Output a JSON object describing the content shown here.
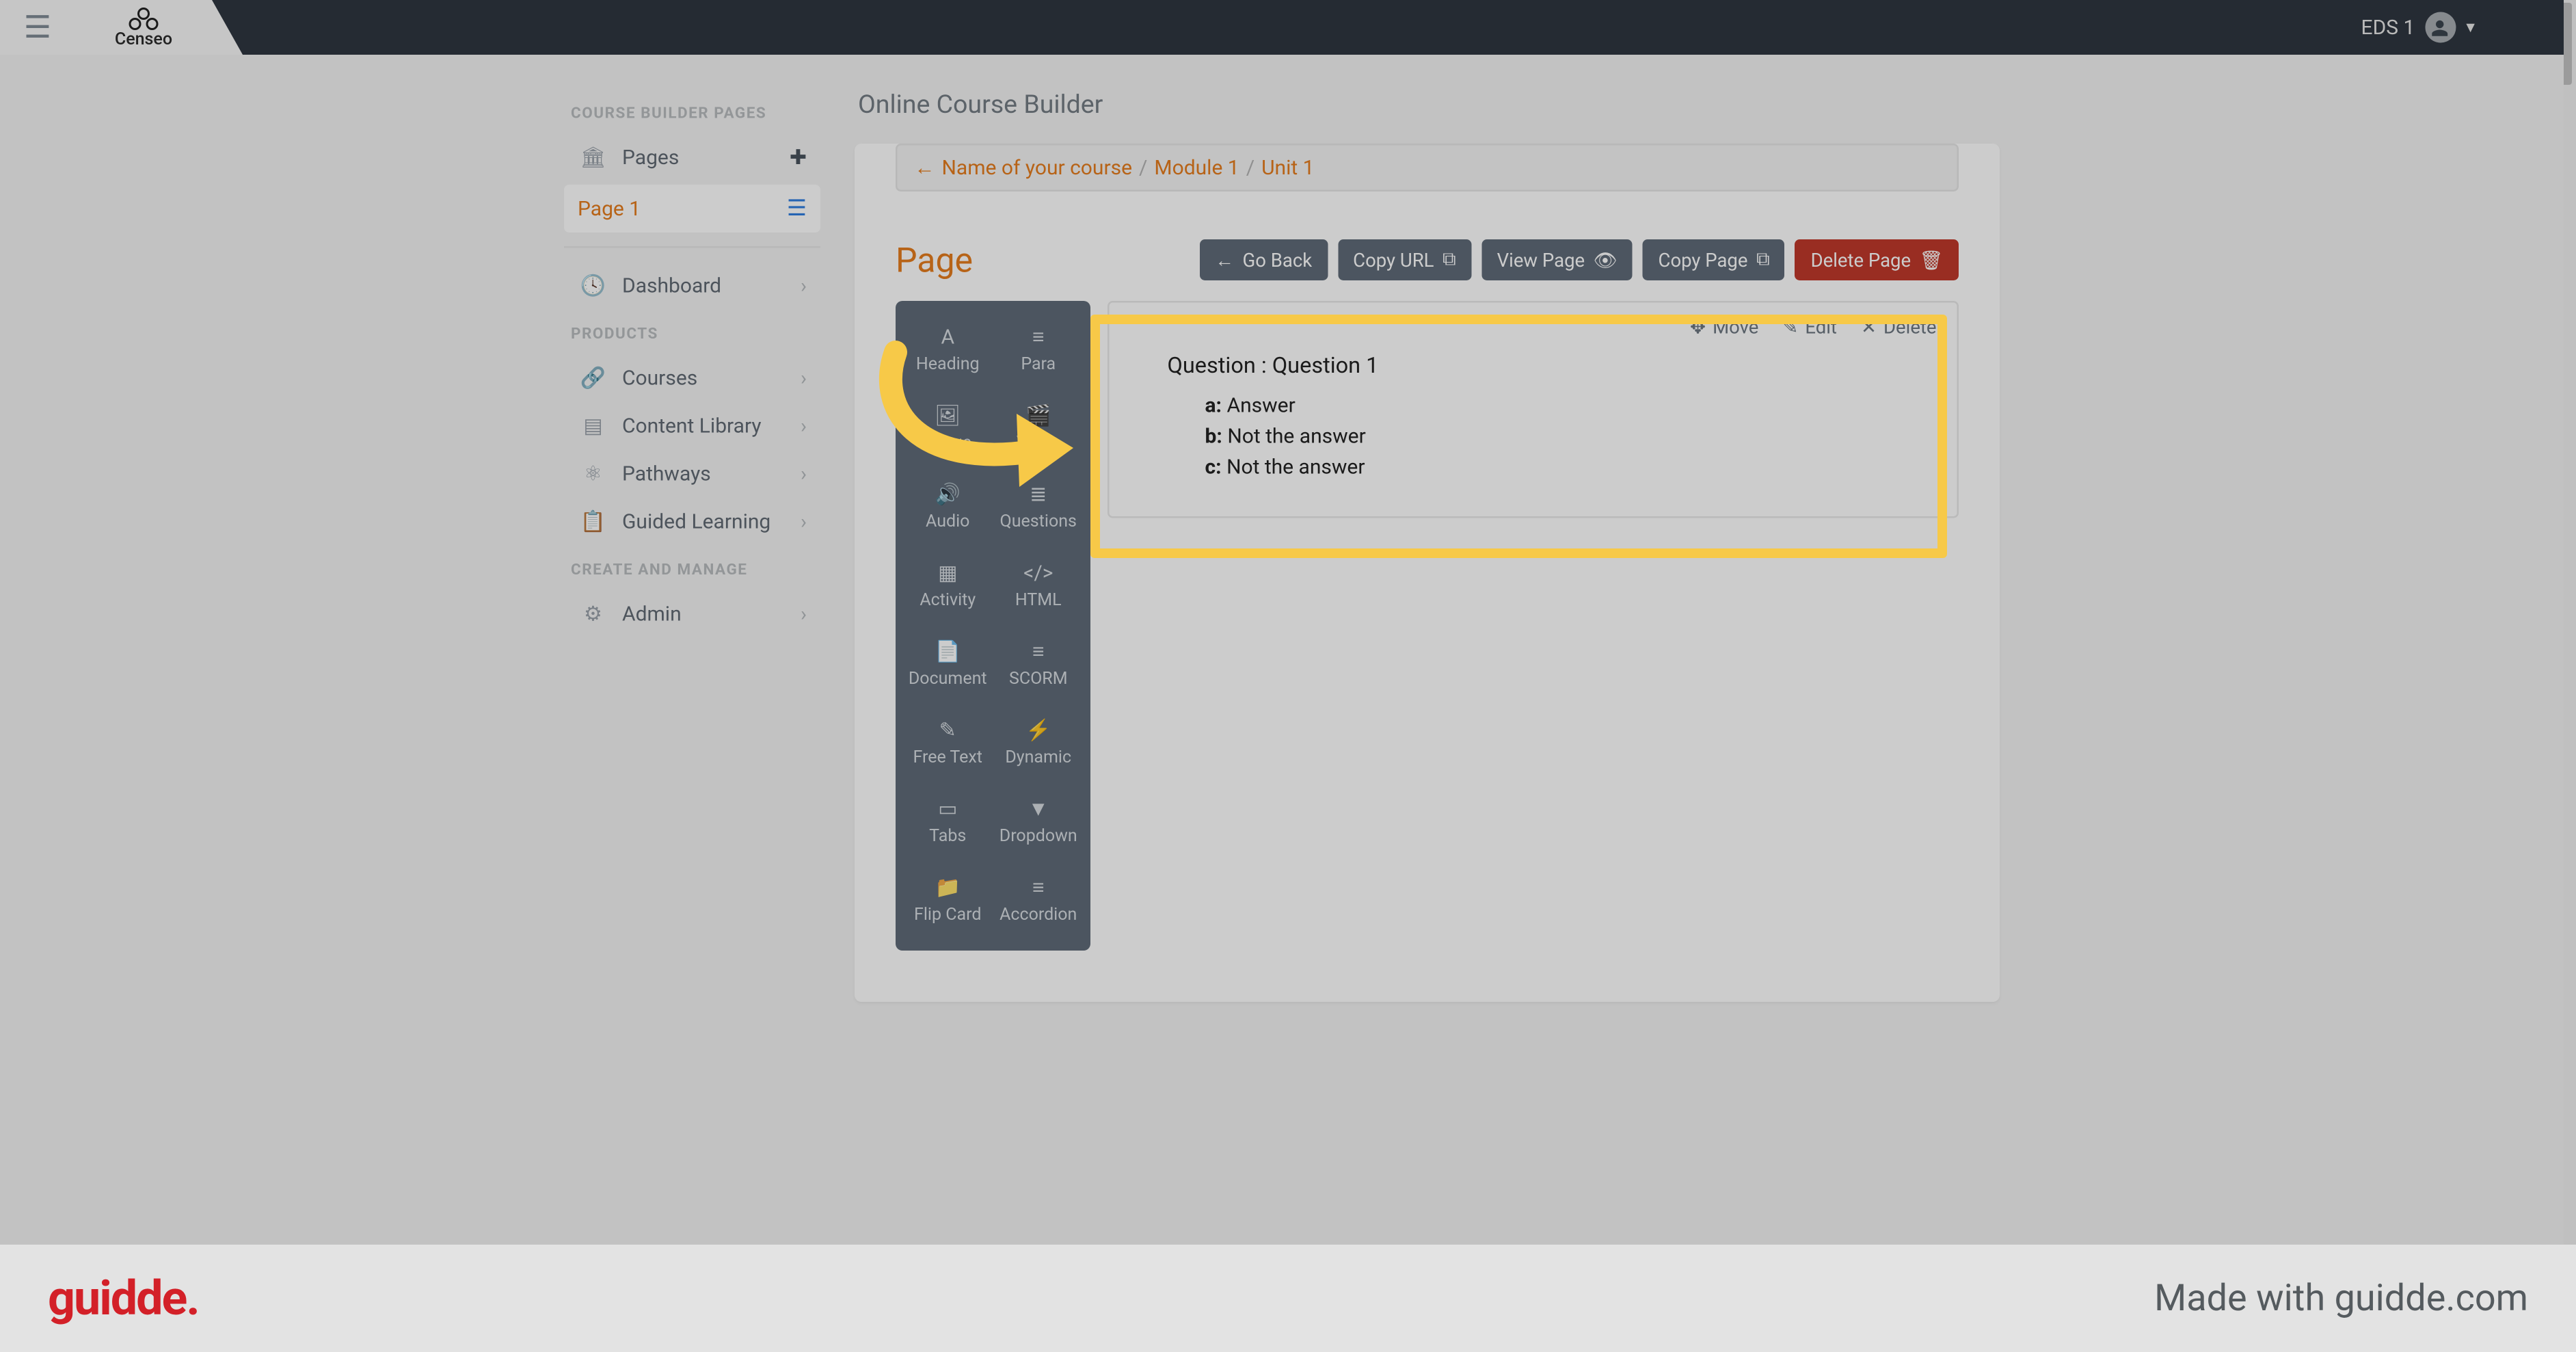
{
  "navbar": {
    "brand": "Censeo",
    "user_label": "EDS 1"
  },
  "sidebar": {
    "section_builder": "COURSE BUILDER PAGES",
    "pages_label": "Pages",
    "page1_label": "Page 1",
    "dashboard_label": "Dashboard",
    "section_products": "PRODUCTS",
    "courses_label": "Courses",
    "content_library_label": "Content Library",
    "pathways_label": "Pathways",
    "guided_learning_label": "Guided Learning",
    "section_create": "CREATE AND MANAGE",
    "admin_label": "Admin"
  },
  "main": {
    "page_header": "Online Course Builder",
    "breadcrumb": {
      "course": "Name of your course",
      "module": "Module 1",
      "unit": "Unit 1"
    },
    "page_title": "Page",
    "buttons": {
      "go_back": "Go Back",
      "copy_url": "Copy URL",
      "view_page": "View Page",
      "copy_page": "Copy Page",
      "delete_page": "Delete Page"
    },
    "palette": {
      "heading": "Heading",
      "para": "Para",
      "image": "Image",
      "video": "Video",
      "audio": "Audio",
      "questions": "Questions",
      "activity": "Activity",
      "html": "HTML",
      "document": "Document",
      "scorm": "SCORM",
      "freetext": "Free Text",
      "dynamic": "Dynamic",
      "tabs": "Tabs",
      "dropdown": "Dropdown",
      "flipcard": "Flip Card",
      "accordion": "Accordion"
    },
    "question_block": {
      "actions": {
        "move": "Move",
        "edit": "Edit",
        "delete": "Delete"
      },
      "title_prefix": "Question : ",
      "title_value": "Question 1",
      "opts": [
        {
          "key": "a:",
          "text": "Answer"
        },
        {
          "key": "b:",
          "text": "Not the answer"
        },
        {
          "key": "c:",
          "text": "Not the answer"
        }
      ]
    }
  },
  "footer": {
    "logo": "guidde.",
    "made_with": "Made with guidde.com"
  }
}
